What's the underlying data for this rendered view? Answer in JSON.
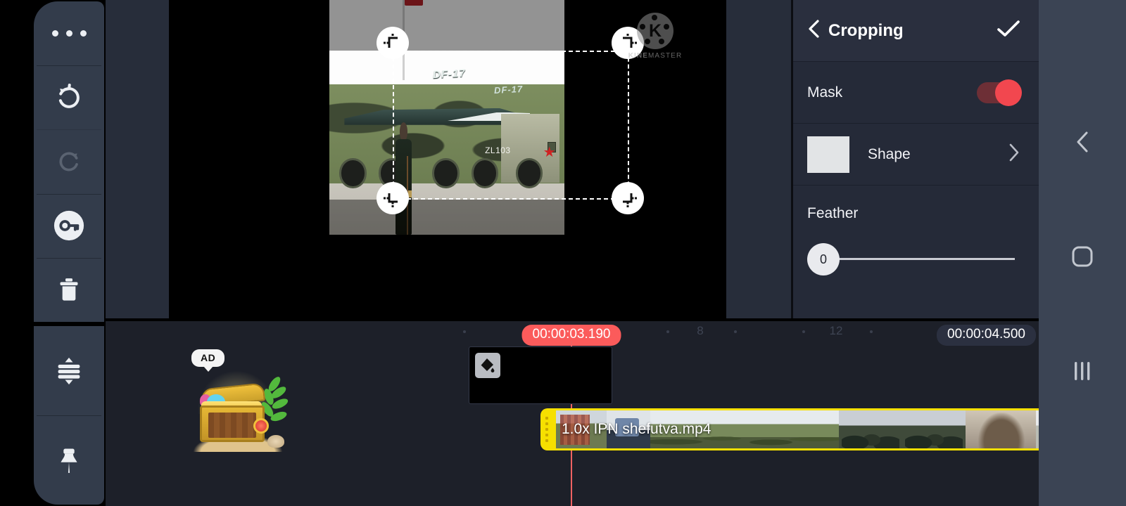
{
  "toolbar": {
    "items": [
      {
        "name": "more-options",
        "icon": "ellipsis-icon",
        "enabled": true
      },
      {
        "name": "undo",
        "icon": "undo-icon",
        "enabled": true
      },
      {
        "name": "redo",
        "icon": "redo-icon",
        "enabled": false
      },
      {
        "name": "unlock",
        "icon": "key-icon",
        "enabled": true
      },
      {
        "name": "delete",
        "icon": "trash-icon",
        "enabled": true
      },
      {
        "name": "expand-collapse",
        "icon": "expand-vertical-icon",
        "enabled": true
      },
      {
        "name": "pin",
        "icon": "pin-icon",
        "enabled": true
      }
    ]
  },
  "preview": {
    "watermark": {
      "letter": "K",
      "brand_bold": "KINE",
      "brand_light": "MASTER"
    },
    "image_texts": {
      "missile_label": "DF-17",
      "missile_label_2": "DF-17",
      "vehicle_id": "ZL103"
    },
    "crop_handles": [
      "top-left",
      "top-right",
      "bottom-left",
      "bottom-right"
    ]
  },
  "panel": {
    "title": "Cropping",
    "back_icon": "chevron-left-icon",
    "confirm_icon": "check-icon",
    "mask": {
      "label": "Mask",
      "enabled": true,
      "accent": "#f2474f"
    },
    "shape": {
      "label": "Shape",
      "swatch_color": "#e2e4e6",
      "chevron_icon": "chevron-right-icon"
    },
    "feather": {
      "label": "Feather",
      "value": "0",
      "min": 0,
      "max": 100
    }
  },
  "timeline": {
    "playhead_time": "00:00:03.190",
    "total_time": "00:00:04.500",
    "ruler_labels": [
      "8",
      "12"
    ],
    "ad": {
      "badge": "AD",
      "icon": "treasure-chest-icon"
    },
    "layer_clip": {
      "icon": "paint-bucket-icon"
    },
    "video_clip": {
      "name": "1.0x IPN shefutva.mp4",
      "border_color": "#f6e000"
    }
  },
  "navbar": {
    "items": [
      {
        "name": "back",
        "icon": "chevron-left-icon"
      },
      {
        "name": "home",
        "icon": "square-rounded-icon"
      },
      {
        "name": "recents",
        "icon": "three-bars-icon"
      }
    ]
  }
}
